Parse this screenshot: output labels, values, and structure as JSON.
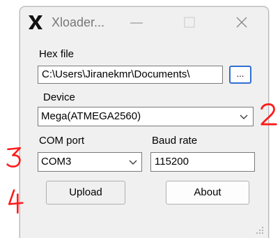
{
  "window": {
    "title": "Xloader...",
    "icon": "x-logo-icon"
  },
  "hex_file": {
    "label": "Hex file",
    "value": "C:\\Users\\Jiranekmr\\Documents\\",
    "browse_label": "..."
  },
  "device": {
    "label": "Device",
    "selected": "Mega(ATMEGA2560)"
  },
  "com_port": {
    "label": "COM port",
    "selected": "COM3"
  },
  "baud_rate": {
    "label": "Baud rate",
    "value": "115200"
  },
  "buttons": {
    "upload_label": "Upload",
    "about_label": "About"
  },
  "annotations": {
    "color": "#ff1a1a",
    "highlight_color": "#fff200",
    "marks": [
      "2",
      "3",
      "4"
    ]
  }
}
